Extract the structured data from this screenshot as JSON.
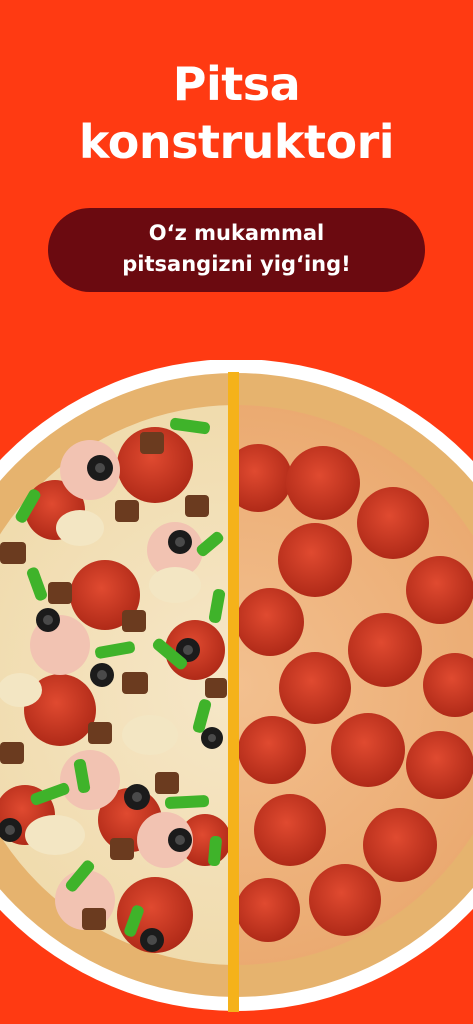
{
  "header": {
    "title_line1": "Pitsa",
    "title_line2": "konstruktori"
  },
  "banner": {
    "line1": "O‘z mukammal",
    "line2": "pitsangizni yig‘ing!"
  },
  "colors": {
    "background": "#ff3a12",
    "banner": "#6b0a10",
    "divider": "#f5b21a",
    "crust": "#e8b46a",
    "pepperoni": "#c8361f",
    "plate": "#ffffff"
  },
  "illustration": {
    "left_half": "combo-pizza",
    "right_half": "pepperoni-pizza"
  }
}
